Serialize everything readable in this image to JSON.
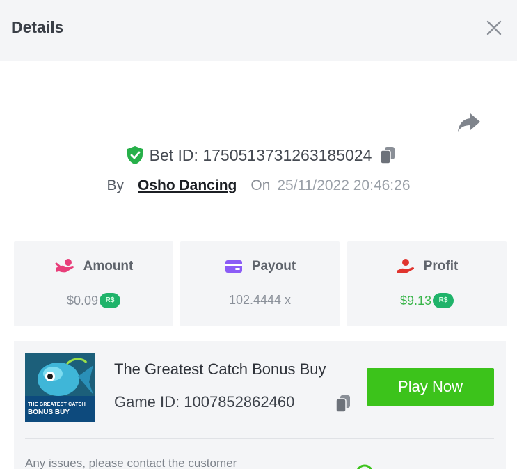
{
  "header": {
    "title": "Details"
  },
  "icons": {
    "close": "close-icon",
    "share": "share-icon",
    "verified": "shield-check-icon",
    "copy": "copy-icon",
    "amount": "hand-coins-icon",
    "payout": "wallet-icon",
    "profit": "profit-hand-icon",
    "support": "chat-support-icon"
  },
  "bet": {
    "id_text": "Bet ID: 1750513731263185024",
    "by_label": "By",
    "user": "Osho Dancing",
    "on_label": "On",
    "date": "25/11/2022 20:46:26"
  },
  "stats": {
    "amount": {
      "label": "Amount",
      "value": "$0.09",
      "badge": "R$"
    },
    "payout": {
      "label": "Payout",
      "value": "102.4444 x"
    },
    "profit": {
      "label": "Profit",
      "value": "$9.13",
      "badge": "R$"
    }
  },
  "game": {
    "name": "The Greatest Catch Bonus Buy",
    "id_text": "Game ID: 1007852862460",
    "play_label": "Play Now",
    "thumb_caption_line1": "THE GREATEST CATCH",
    "thumb_caption_line2": "BONUS BUY"
  },
  "footer": {
    "support_text": "Any issues, please contact the customer"
  },
  "colors": {
    "accent_green": "#3cc31b",
    "profit_green": "#39b54a",
    "coin_green": "#1fb36a",
    "payout_purple": "#8b5cf6",
    "amount_pink": "#e83e7a",
    "profit_red": "#e0342e",
    "panel_bg": "#f4f5f7"
  }
}
